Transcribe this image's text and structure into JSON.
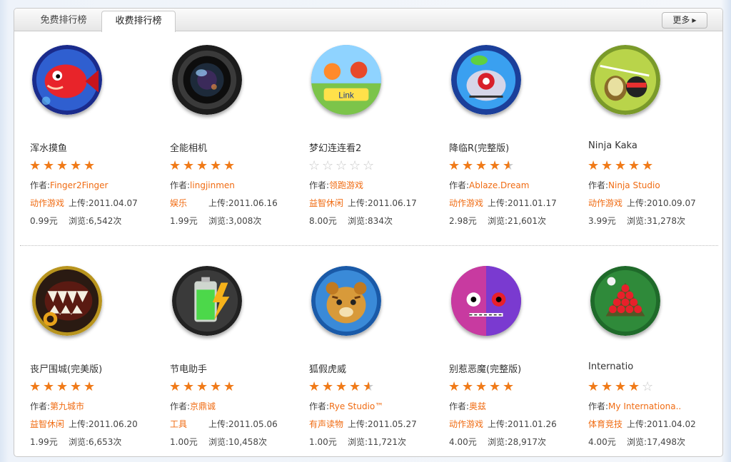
{
  "tabs": {
    "free": "免费排行榜",
    "paid": "收费排行榜"
  },
  "more_label": "更多",
  "labels": {
    "author": "作者:",
    "upload": "上传:",
    "views": "浏览:"
  },
  "colors": {
    "accent": "#f06b12",
    "star": "#f07a18",
    "star_empty": "#c8c8c8"
  },
  "rows": [
    [
      {
        "name": "浑水摸鱼",
        "icon": "fish-game-icon",
        "rating": 5,
        "author": "Finger2Finger",
        "category": "动作游戏",
        "upload": "2011.04.07",
        "price": "0.99元",
        "views": "6,542次"
      },
      {
        "name": "全能相机",
        "icon": "camera-lens-icon",
        "rating": 5,
        "author": "lingjinmen",
        "category": "娱乐",
        "upload": "2011.06.16",
        "price": "1.99元",
        "views": "3,008次"
      },
      {
        "name": "梦幻连连看2",
        "icon": "link-link-game-icon",
        "rating": 0,
        "author": "领跑游戏",
        "category": "益智休闲",
        "upload": "2011.06.17",
        "price": "8.00元",
        "views": "834次"
      },
      {
        "name": "降临R(完整版)",
        "icon": "robot-monster-icon",
        "rating": 4.5,
        "author": "Ablaze.Dream",
        "category": "动作游戏",
        "upload": "2011.01.17",
        "price": "2.98元",
        "views": "21,601次"
      },
      {
        "name": "Ninja Kaka",
        "icon": "ninja-fruit-icon",
        "rating": 5,
        "author": "Ninja Studio",
        "category": "动作游戏",
        "upload": "2010.09.07",
        "price": "3.99元",
        "views": "31,278次"
      }
    ],
    [
      {
        "name": "丧尸围城(完美版)",
        "icon": "zombie-mouth-icon",
        "rating": 5,
        "author": "第九城市",
        "category": "益智休闲",
        "upload": "2011.06.20",
        "price": "1.99元",
        "views": "6,653次"
      },
      {
        "name": "节电助手",
        "icon": "battery-icon",
        "rating": 5,
        "author": "京鼎诚",
        "category": "工具",
        "upload": "2011.05.06",
        "price": "1.00元",
        "views": "10,458次"
      },
      {
        "name": "狐假虎威",
        "icon": "tiger-book-icon",
        "rating": 4.5,
        "author": "Rye Studio™",
        "category": "有声读物",
        "upload": "2011.05.27",
        "price": "1.00元",
        "views": "11,721次"
      },
      {
        "name": "别惹恶魔(完整版)",
        "icon": "devil-face-icon",
        "rating": 5,
        "author": "奥兹",
        "category": "动作游戏",
        "upload": "2011.01.26",
        "price": "4.00元",
        "views": "28,917次"
      },
      {
        "name": "Internatio",
        "icon": "snooker-balls-icon",
        "rating": 4,
        "author": "My Internationa..",
        "category": "体育竞技",
        "upload": "2011.04.02",
        "price": "4.00元",
        "views": "17,498次"
      }
    ]
  ]
}
